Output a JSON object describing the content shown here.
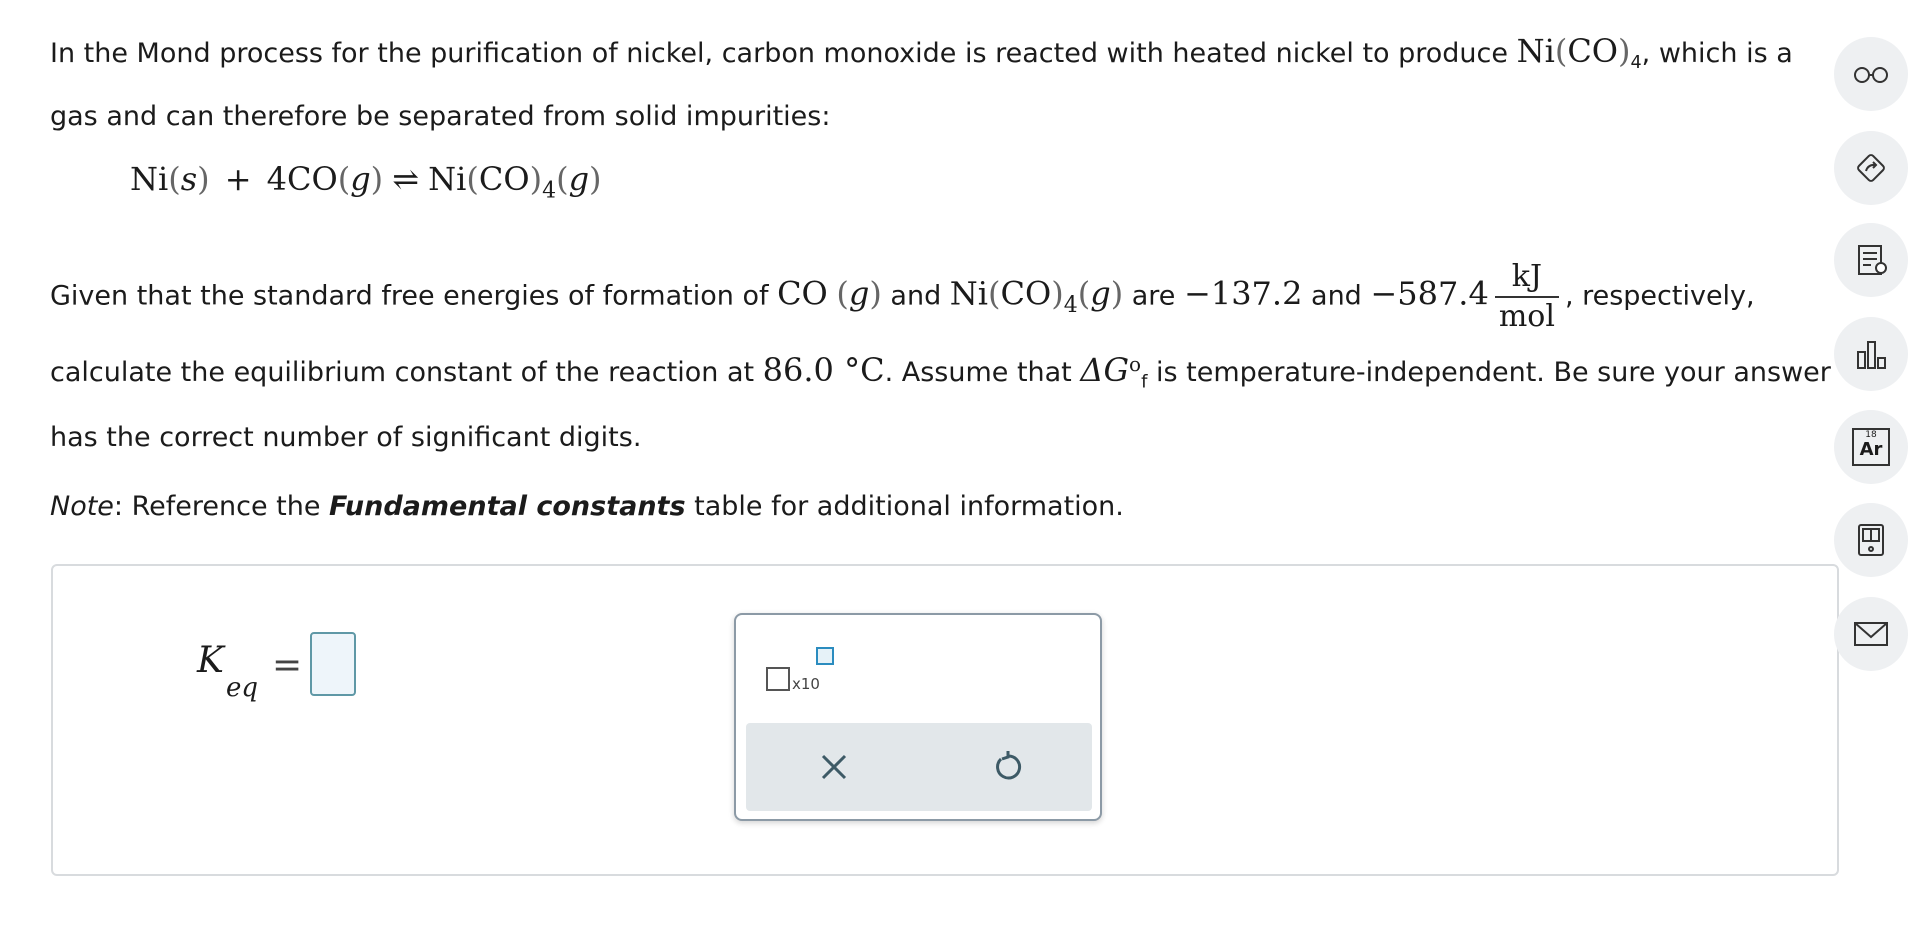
{
  "question": {
    "p1": {
      "text_a": "In the Mond process for the purification of nickel, carbon monoxide is reacted with heated nickel to produce ",
      "formula_ni": "Ni",
      "formula_co": "CO",
      "formula_sub": "4",
      "text_b": ", which is a gas and can therefore be separated from solid impurities:"
    },
    "reaction": {
      "ni": "Ni",
      "s": "s",
      "plus": "+",
      "co": "4CO",
      "g1": "g",
      "arrow": "⇌",
      "product_ni": "Ni",
      "product_co": "CO",
      "product_sub": "4",
      "g2": "g"
    },
    "p2": {
      "text_a": "Given that the standard free energies of formation of ",
      "co": "CO",
      "g1": "g",
      "and": " and ",
      "ni": "Ni",
      "co2": "CO",
      "sub": "4",
      "g2": "g",
      "are": " are ",
      "v1": "−137.2",
      "and2": " and ",
      "v2": "−587.4",
      "unit_num": "kJ",
      "unit_den": "mol",
      "text_b": ", respectively, calculate the equilibrium constant of the reaction at ",
      "temp": "86.0 °C",
      "text_c": ". Assume that ",
      "delta": "ΔG",
      "delta_sup": "o",
      "delta_sub": "f",
      "text_d": " is temperature-independent. Be sure your answer has the correct number of significant digits."
    },
    "note": {
      "label": "Note",
      "text_a": ": Reference the ",
      "bold": "Fundamental constants",
      "text_b": " table for additional information."
    }
  },
  "answer": {
    "k": "K",
    "sub": "eq",
    "equals": "="
  },
  "tools": {
    "sci_label": "x10"
  },
  "sidebar": {
    "icons": [
      "glasses-icon",
      "tag-icon",
      "notes-icon",
      "chart-icon",
      "periodic-table-icon",
      "calculator-icon",
      "mail-icon"
    ],
    "periodic_number": "18",
    "periodic_symbol": "Ar"
  },
  "colors": {
    "input_border": "#5f98a6",
    "input_fill": "#eef5fa",
    "toolbar_bg": "#e2e7ea",
    "accent": "#2b8cbf"
  }
}
